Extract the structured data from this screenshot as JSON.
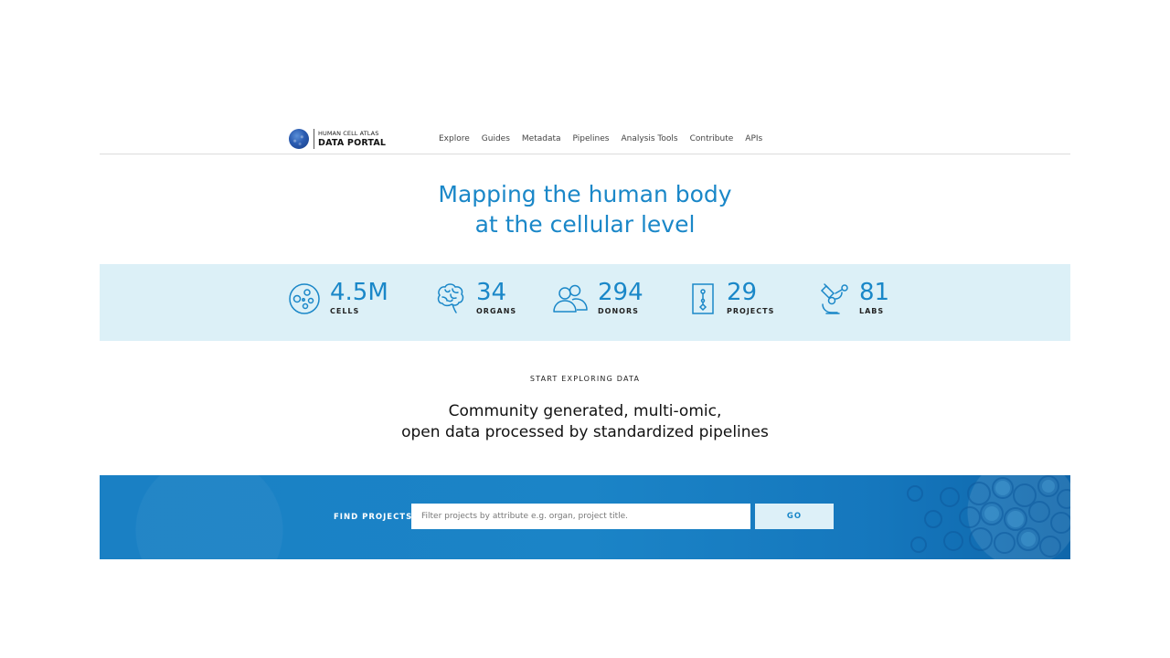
{
  "header": {
    "logo": {
      "line1": "HUMAN CELL ATLAS",
      "line2": "DATA PORTAL"
    },
    "nav": [
      {
        "label": "Explore"
      },
      {
        "label": "Guides"
      },
      {
        "label": "Metadata"
      },
      {
        "label": "Pipelines"
      },
      {
        "label": "Analysis Tools"
      },
      {
        "label": "Contribute"
      },
      {
        "label": "APIs"
      }
    ]
  },
  "hero": {
    "title_line1": "Mapping the human body",
    "title_line2": "at the cellular level"
  },
  "stats": [
    {
      "value": "4.5M",
      "label": "CELLS",
      "icon": "cells-icon"
    },
    {
      "value": "34",
      "label": "ORGANS",
      "icon": "brain-icon"
    },
    {
      "value": "294",
      "label": "DONORS",
      "icon": "donors-icon"
    },
    {
      "value": "29",
      "label": "PROJECTS",
      "icon": "projects-icon"
    },
    {
      "value": "81",
      "label": "LABS",
      "icon": "microscope-icon"
    }
  ],
  "explore": {
    "eyebrow": "START EXPLORING DATA",
    "tagline_line1": "Community generated, multi-omic,",
    "tagline_line2": "open data processed by standardized pipelines"
  },
  "search": {
    "label": "FIND PROJECTS",
    "placeholder": "Filter projects by attribute e.g. organ, project title.",
    "value": "",
    "button_label": "GO"
  },
  "colors": {
    "accent": "#1a87c8",
    "stats_band": "#dcf0f7",
    "search_band": "#1a80c4"
  }
}
